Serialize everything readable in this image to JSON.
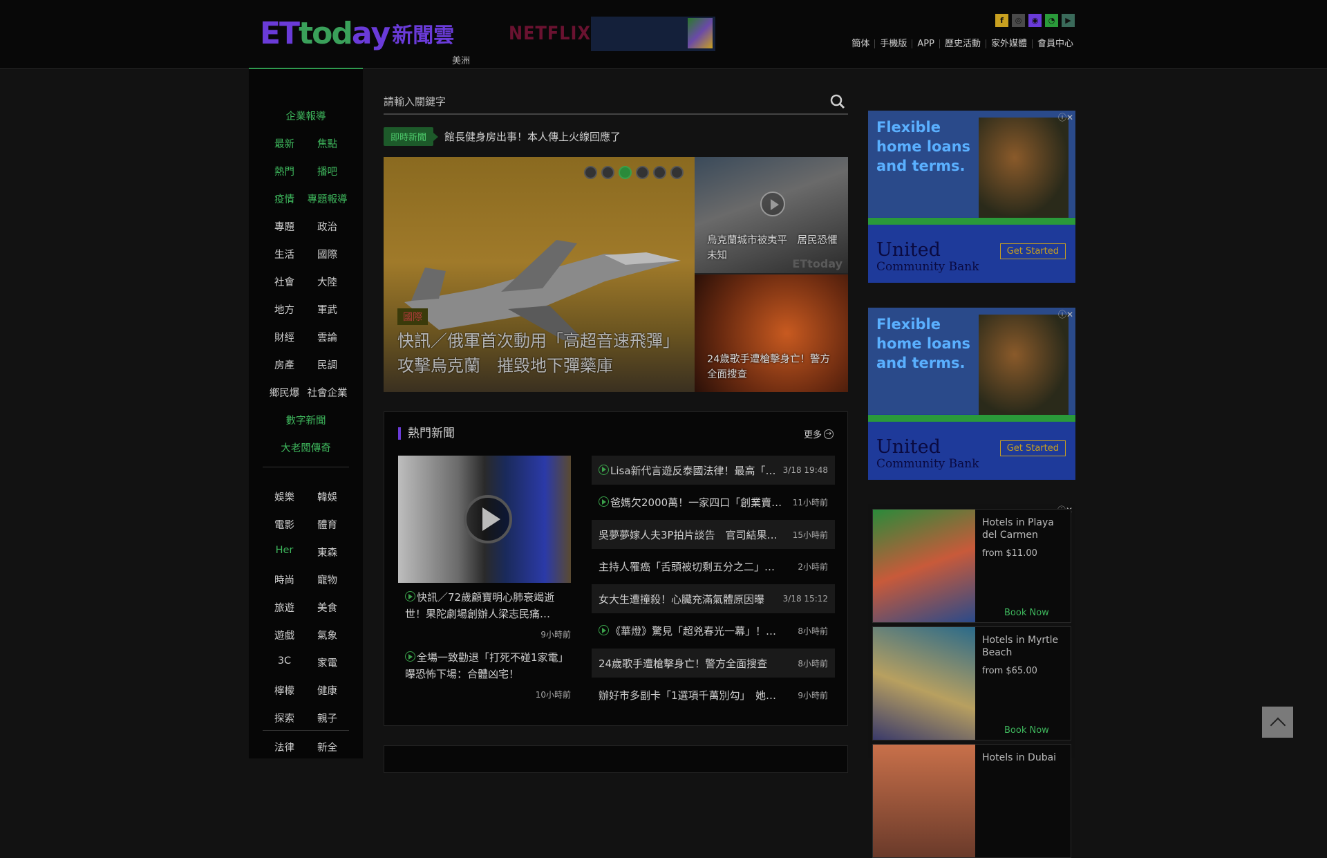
{
  "header": {
    "logo_text": {
      "et": "ET",
      "today": "tod",
      "a": "a",
      "y": "y",
      "cn": "新聞雲"
    },
    "logo_sub": "美洲",
    "ad_netflix": "NETFLIX",
    "social_icons": [
      "facebook-icon",
      "instagram-icon",
      "line-icon",
      "rss-icon",
      "youtube-icon"
    ],
    "social_colors": [
      "#c8a020",
      "#4a4a4a",
      "#6a3bd8",
      "#2a9a3a",
      "#3a6a5a"
    ],
    "links": [
      "簡体",
      "手機版",
      "APP",
      "歷史活動",
      "家外媒體",
      "會員中心"
    ]
  },
  "sidebar": {
    "rows": [
      {
        "items": [
          "企業報導"
        ],
        "green": true
      },
      {
        "items": [
          "最新",
          "焦點"
        ],
        "green": true
      },
      {
        "items": [
          "熱門",
          "播吧"
        ],
        "green": true
      },
      {
        "items": [
          "疫情",
          "專題報導"
        ],
        "green": true
      },
      {
        "items": [
          "專題",
          "政治"
        ],
        "green": false
      },
      {
        "items": [
          "生活",
          "國際"
        ],
        "green": false
      },
      {
        "items": [
          "社會",
          "大陸"
        ],
        "green": false
      },
      {
        "items": [
          "地方",
          "軍武"
        ],
        "green": false
      },
      {
        "items": [
          "財經",
          "雲論"
        ],
        "green": false
      },
      {
        "items": [
          "房產",
          "民調"
        ],
        "green": false
      },
      {
        "items": [
          "鄉民爆",
          "社會企業"
        ],
        "green": false
      },
      {
        "items": [
          "數字新聞"
        ],
        "green": true
      },
      {
        "items": [
          "大老闆傳奇"
        ],
        "green": true
      },
      {
        "items": [
          "娛樂",
          "韓娛"
        ],
        "green": false
      },
      {
        "items": [
          "電影",
          "體育"
        ],
        "green": false
      },
      {
        "items": [
          "Her",
          "東森"
        ],
        "green": false
      },
      {
        "items": [
          "時尚",
          "寵物"
        ],
        "green": false
      },
      {
        "items": [
          "旅遊",
          "美食"
        ],
        "green": false
      },
      {
        "items": [
          "遊戲",
          "氣象"
        ],
        "green": false
      },
      {
        "items": [
          "3C",
          "家電"
        ],
        "green": false
      },
      {
        "items": [
          "檸檬",
          "健康"
        ],
        "green": false
      },
      {
        "items": [
          "探索",
          "親子"
        ],
        "green": false
      },
      {
        "items": [
          "法律",
          "新全"
        ],
        "green": false
      }
    ]
  },
  "search": {
    "placeholder": "請輸入關鍵字"
  },
  "ticker": {
    "badge": "即時新聞",
    "text": "館長健身房出事！本人傳上火線回應了"
  },
  "slider": {
    "tag": "國際",
    "title": "快訊／俄軍首次動用「高超音速飛彈」攻擊烏克蘭　摧毀地下彈藥庫",
    "side1_caption": "烏克蘭城市被夷平　居民恐懼未知",
    "side2_caption": "24歲歌手遭槍擊身亡！警方全面搜查",
    "watermark": "ETtoday",
    "active_dot": 2,
    "dot_count": 6
  },
  "hot": {
    "title": "熱門新聞",
    "more": "更多",
    "left": [
      {
        "text": "快訊／72歲顧寶明心肺衰竭逝世！果陀劇場創辦人梁志民痛…",
        "time": "9小時前",
        "video": true
      },
      {
        "text": "全場一致勸退「打死不碰1家電」　曝恐怖下場：合體凶宅！",
        "time": "10小時前",
        "video": true
      }
    ],
    "right": [
      {
        "text": "Lisa新代言遊反泰國法律！最高「…",
        "time": "3/18 19:48",
        "video": true
      },
      {
        "text": "爸媽欠2000萬！一家四口「創業賣…",
        "time": "11小時前",
        "video": true
      },
      {
        "text": "吳夢夢嫁人夫3P拍片談告　官司結果…",
        "time": "15小時前",
        "video": false
      },
      {
        "text": "主持人罹癌「舌頭被切剩五分之二」…",
        "time": "2小時前",
        "video": false
      },
      {
        "text": "女大生遭撞殺！心臟充滿氣體原因曝",
        "time": "3/18 15:12",
        "video": false
      },
      {
        "text": "《華燈》驚見「超兇春光一幕」！…",
        "time": "8小時前",
        "video": true
      },
      {
        "text": "24歲歌手遭槍擊身亡！警方全面搜查",
        "time": "8小時前",
        "video": false
      },
      {
        "text": "辦好市多副卡「1選項千萬別勾」　她…",
        "time": "9小時前",
        "video": false
      }
    ]
  },
  "ads": {
    "headline": "Flexible home loans and terms.",
    "bank": "United",
    "bank_sub": "Community Bank",
    "cta": "Get Started",
    "close": "ⓘ✕"
  },
  "hotels": [
    {
      "name": "Hotels in Playa del Carmen",
      "price": "from $11.00",
      "book": "Book Now"
    },
    {
      "name": "Hotels in Myrtle Beach",
      "price": "from $65.00",
      "book": "Book Now"
    },
    {
      "name": "Hotels in Dubai",
      "price": "",
      "book": ""
    }
  ]
}
